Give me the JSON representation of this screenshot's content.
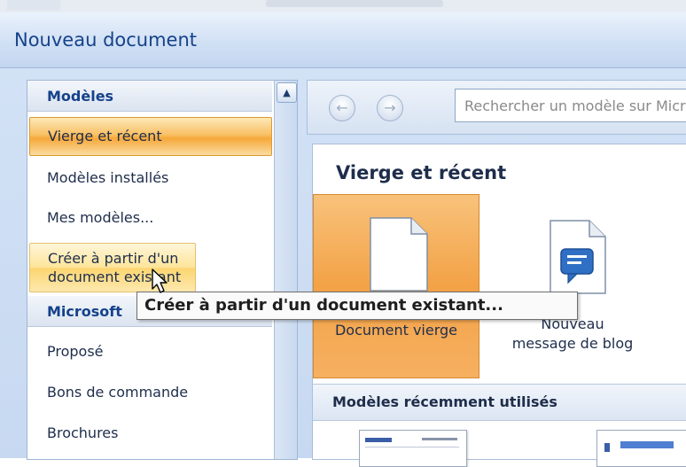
{
  "window": {
    "title": "Nouveau document"
  },
  "sidebar": {
    "header_label": "Modèles",
    "items": [
      {
        "label": "Vierge et récent",
        "state": "selected"
      },
      {
        "label": "Modèles installés"
      },
      {
        "label": "Mes modèles..."
      },
      {
        "label": "Créer à partir d'un document existant",
        "state": "hover"
      }
    ],
    "section_label": "Microsoft",
    "office_items": [
      {
        "label": "Proposé"
      },
      {
        "label": "Bons de commande"
      },
      {
        "label": "Brochures"
      }
    ]
  },
  "toolbar": {
    "search_placeholder": "Rechercher un modèle sur Microsoft Office Online"
  },
  "main": {
    "title": "Vierge et récent",
    "tiles": [
      {
        "label": "Document vierge",
        "icon": "blank-document-icon",
        "state": "selected"
      },
      {
        "label_line1": "Nouveau",
        "label_line2": "message de blog",
        "icon": "blog-post-icon"
      }
    ],
    "recent_header": "Modèles récemment utilisés"
  },
  "tooltip": {
    "text": "Créer à partir d'un document existant..."
  },
  "colors": {
    "accent_selected": "#f6a83a",
    "hover": "#fde49a",
    "title_text": "#15428b",
    "frame": "#c7d9f1"
  }
}
